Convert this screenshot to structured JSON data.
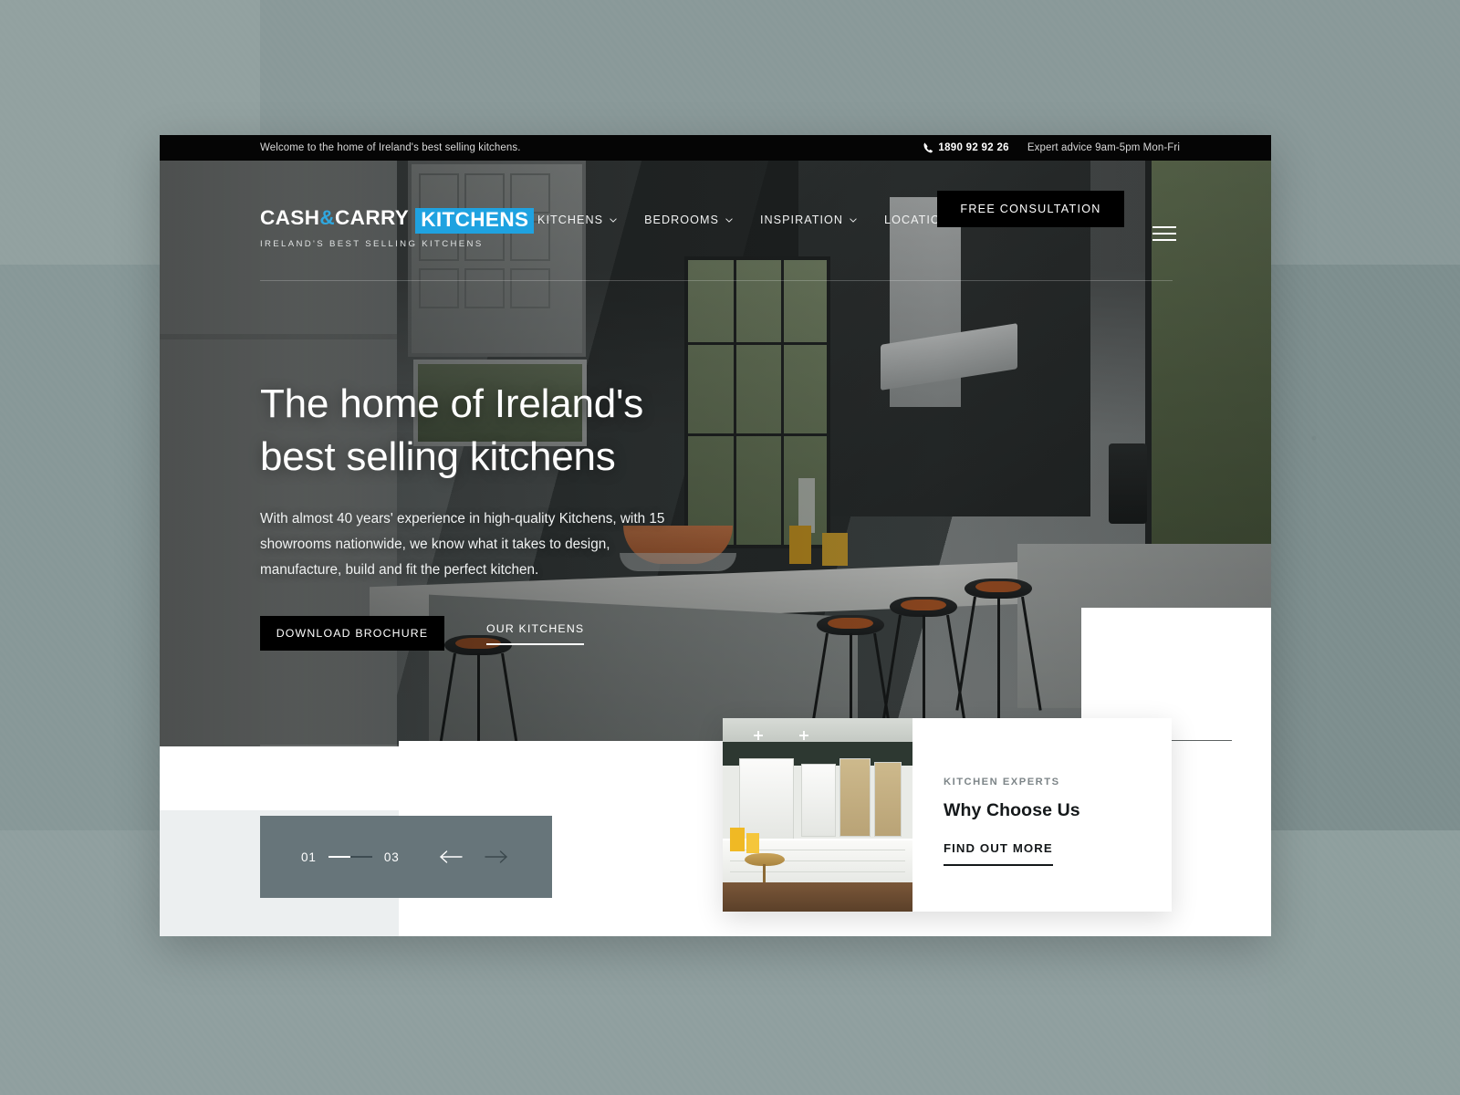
{
  "topbar": {
    "welcome": "Welcome to the home of Ireland's best selling kitchens.",
    "phone_icon": "phone-icon",
    "phone": "1890 92 92 26",
    "hours": "Expert advice 9am-5pm Mon-Fri"
  },
  "brand": {
    "cash": "CASH",
    "amp": "&",
    "carry": "CARRY",
    "kitchens": "KITCHENS",
    "tagline": "IRELAND'S BEST SELLING KITCHENS",
    "accent_color": "#1fa2e0"
  },
  "nav": {
    "items": [
      {
        "label": "KITCHENS",
        "has_dropdown": true
      },
      {
        "label": "BEDROOMS",
        "has_dropdown": true
      },
      {
        "label": "INSPIRATION",
        "has_dropdown": true
      },
      {
        "label": "LOCATIONS",
        "has_dropdown": false
      }
    ],
    "cta_label": "FREE CONSULTATION",
    "menu_icon": "hamburger-menu-icon"
  },
  "hero": {
    "title_line1": "The home of Ireland's",
    "title_line2": "best selling kitchens",
    "subtitle": "With almost 40 years' experience in high-quality Kitchens, with 15 showrooms nationwide, we know what it takes to design, manufacture, build and fit the perfect kitchen.",
    "primary_button": "DOWNLOAD BROCHURE",
    "secondary_link": "OUR KITCHENS"
  },
  "slider": {
    "current": "01",
    "total": "03",
    "prev_icon": "arrow-left-icon",
    "next_icon": "arrow-right-icon",
    "bar_color": "#67757a"
  },
  "why_choose_us": {
    "eyebrow": "KITCHEN EXPERTS",
    "title": "Why Choose Us",
    "link": "FIND OUT MORE"
  }
}
